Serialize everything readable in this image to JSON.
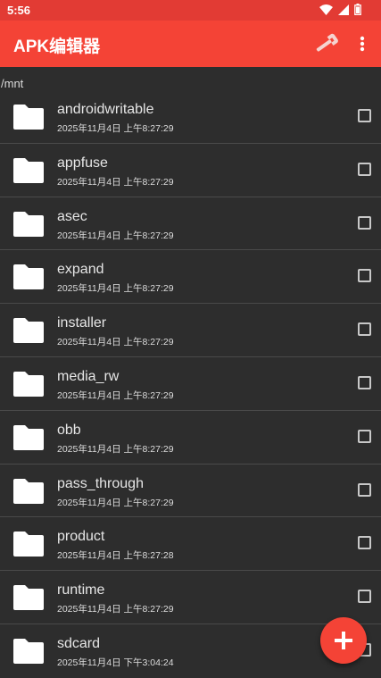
{
  "status_bar": {
    "time": "5:56",
    "icons": [
      "wifi-icon",
      "signal-icon",
      "battery-icon"
    ]
  },
  "app_bar": {
    "title": "APK编辑器",
    "actions": [
      "wrench-icon",
      "more-vert-icon"
    ]
  },
  "current_path": "/mnt",
  "files": [
    {
      "name": "androidwritable",
      "date": "2025年11月4日 上午8:27:29"
    },
    {
      "name": "appfuse",
      "date": "2025年11月4日 上午8:27:29"
    },
    {
      "name": "asec",
      "date": "2025年11月4日 上午8:27:29"
    },
    {
      "name": "expand",
      "date": "2025年11月4日 上午8:27:29"
    },
    {
      "name": "installer",
      "date": "2025年11月4日 上午8:27:29"
    },
    {
      "name": "media_rw",
      "date": "2025年11月4日 上午8:27:29"
    },
    {
      "name": "obb",
      "date": "2025年11月4日 上午8:27:29"
    },
    {
      "name": "pass_through",
      "date": "2025年11月4日 上午8:27:29"
    },
    {
      "name": "product",
      "date": "2025年11月4日 上午8:27:28"
    },
    {
      "name": "runtime",
      "date": "2025年11月4日 上午8:27:29"
    },
    {
      "name": "sdcard",
      "date": "2025年11月4日 下午3:04:24"
    }
  ],
  "fab": {
    "icon": "plus-icon"
  },
  "colors": {
    "primary": "#f44336",
    "status_bar": "#e23b34",
    "background": "#2d2d2d",
    "folder": "#ffffff"
  }
}
